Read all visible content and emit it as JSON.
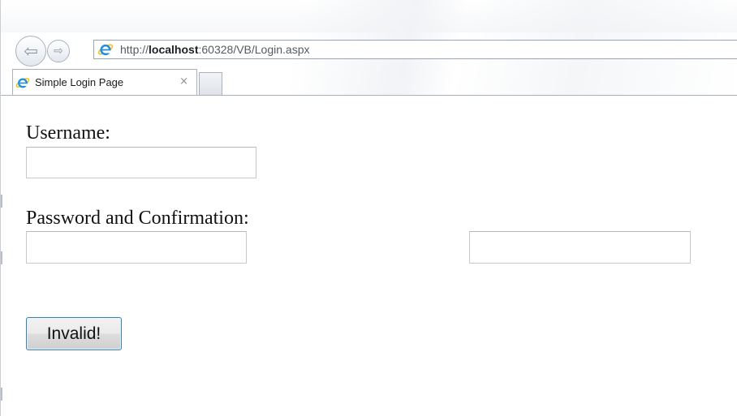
{
  "browser": {
    "url_prefix": "http://",
    "url_host": "localhost",
    "url_rest": ":60328/VB/Login.aspx",
    "tab_title": "Simple Login Page",
    "tab_close_glyph": "×",
    "back_glyph": "⇦",
    "forward_glyph": "⇨",
    "icons": {
      "back": "back-arrow-icon",
      "forward": "forward-arrow-icon",
      "page": "internet-explorer-icon",
      "close": "close-icon"
    }
  },
  "form": {
    "username_label": "Username:",
    "username_value": "",
    "password_label": "Password and Confirmation:",
    "password_value": "",
    "confirmation_value": "",
    "submit_label": "Invalid!"
  },
  "colors": {
    "ie_blue": "#1f8ee0",
    "ie_gold": "#f3c11a",
    "button_border": "#3c7fb1"
  }
}
